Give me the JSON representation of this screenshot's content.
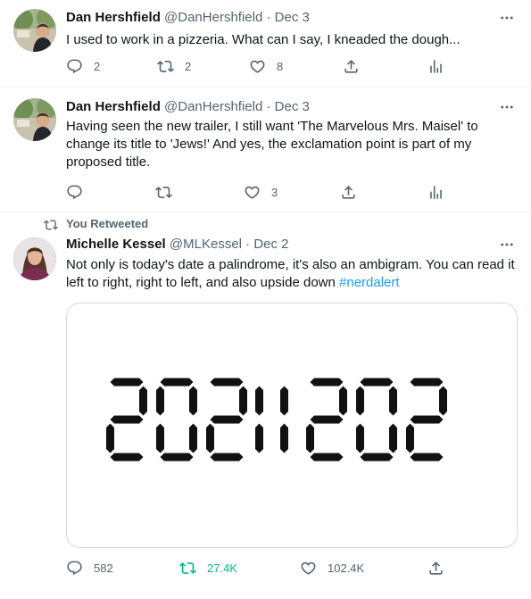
{
  "tweets": [
    {
      "author_name": "Dan Hershfield",
      "handle": "@DanHershfield",
      "separator": "·",
      "date": "Dec 3",
      "text": "I used to work in a pizzeria. What can I say, I kneaded the dough...",
      "replies": "2",
      "retweets": "2",
      "likes": "8"
    },
    {
      "author_name": "Dan Hershfield",
      "handle": "@DanHershfield",
      "separator": "·",
      "date": "Dec 3",
      "text": "Having seen the new trailer, I still want 'The Marvelous Mrs. Maisel' to change its title to 'Jews!' And yes, the exclamation point is part of my proposed title.",
      "replies": "",
      "retweets": "",
      "likes": "3"
    },
    {
      "retweet_label": "You Retweeted",
      "author_name": "Michelle Kessel",
      "handle": "@MLKessel",
      "separator": "·",
      "date": "Dec 2",
      "text": "Not only is today's date a palindrome, it's also an ambigram. You can read it left to right, right to left, and also upside down ",
      "hashtag": "#nerdalert",
      "media_caption": "20211202",
      "replies": "582",
      "retweets": "27.4K",
      "likes": "102.4K"
    }
  ],
  "colors": {
    "text": "#0f1419",
    "muted": "#536471",
    "link": "#1d9bf0",
    "retweeted": "#00ba7c",
    "border": "#eff3f4"
  }
}
